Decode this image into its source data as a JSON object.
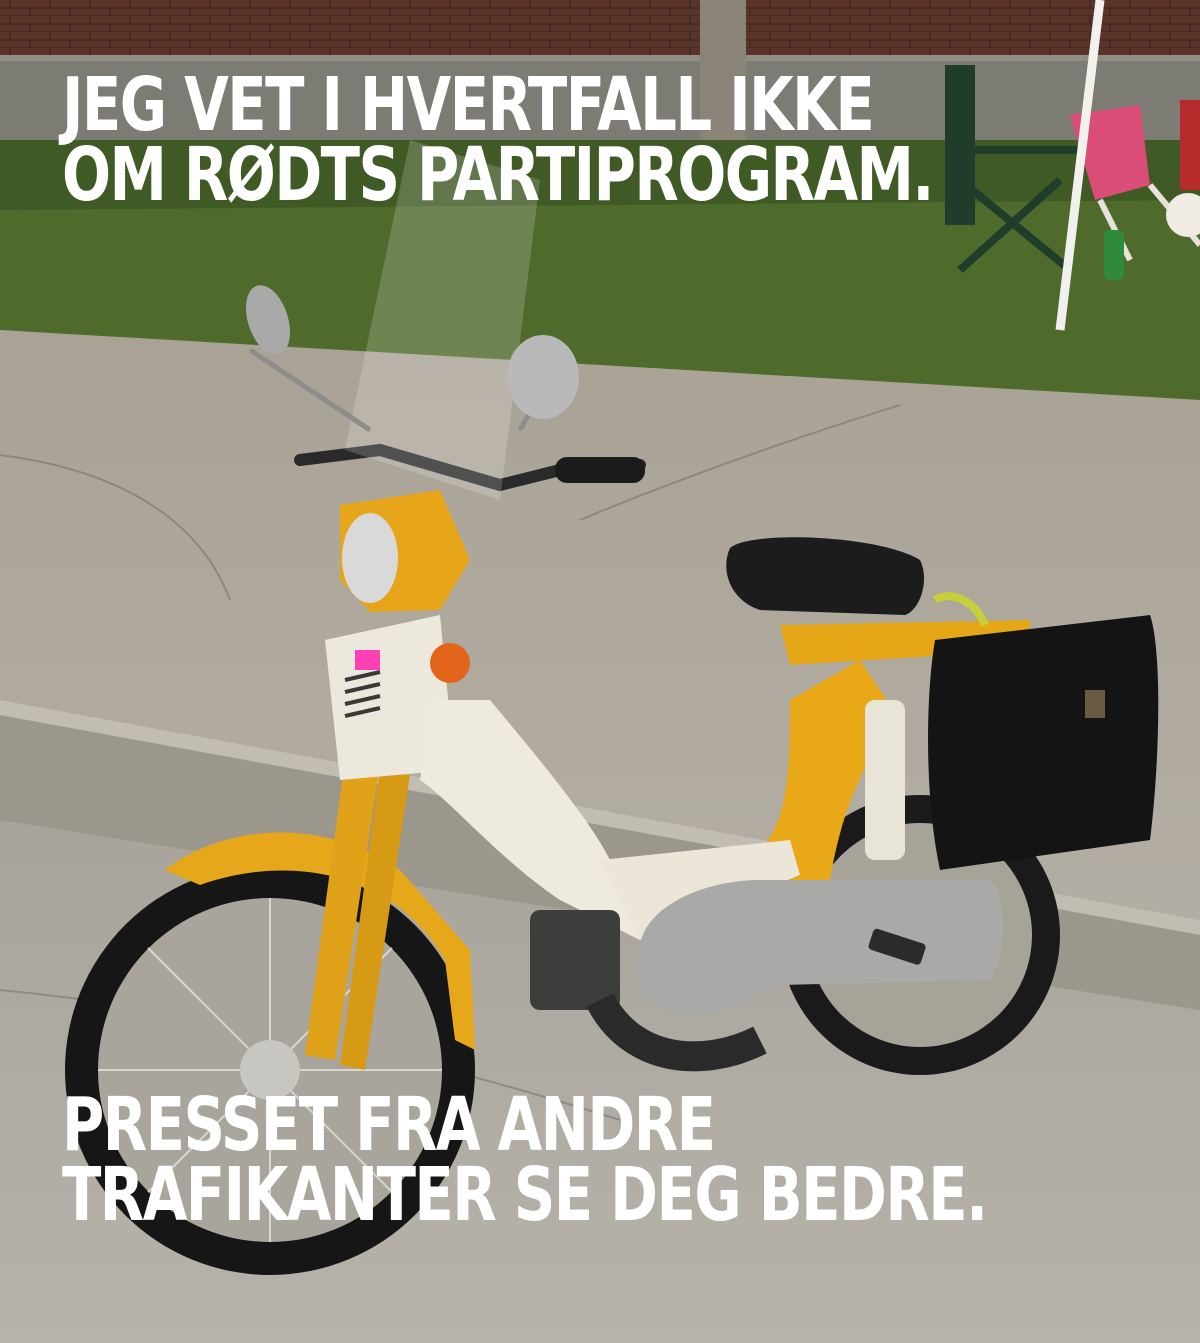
{
  "meme": {
    "top_text": [
      "JEG VET I HVERTFALL IKKE",
      "OM RØDTS PARTIPROGRAM."
    ],
    "bottom_text": [
      "PRESSET FRA ANDRE",
      "TRAFIKANTER SE DEG BEDRE."
    ]
  },
  "colors": {
    "caption": "#ffffff",
    "brick": "#5a3429",
    "grass": "#4f6b2c",
    "pavement": "#aaa59b",
    "moped_yellow": "#e8a818",
    "moped_white": "#ede8dc",
    "seat_black": "#1c1c1c"
  }
}
